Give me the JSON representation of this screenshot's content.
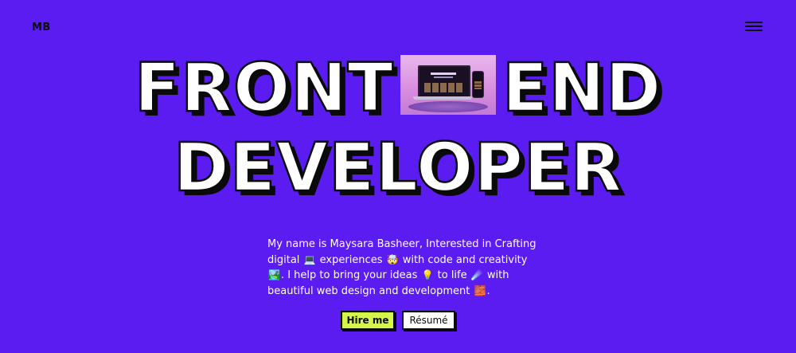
{
  "header": {
    "logo": "MB",
    "menu_icon": "hamburger-menu-icon"
  },
  "hero": {
    "line1_left": "FRONT",
    "line1_right": "END",
    "line2": "DEVELOPER",
    "image_description_icon": "laptop-mockup-image"
  },
  "intro": {
    "part1": "My name is Maysara Basheer, Interested in Crafting digital",
    "emoji1": "💻",
    "part2": "experiences",
    "emoji2": "🤯",
    "part3": "with code and creativity",
    "emoji3": "🏞️",
    "part4": ". I help to bring your ideas",
    "emoji4": "💡",
    "part5": "to life",
    "emoji5": "☄️",
    "part6": "with beautiful web design and development",
    "emoji6": "🧱",
    "part7": "."
  },
  "actions": {
    "hire_label": "Hire me",
    "resume_label": "Résumé"
  },
  "colors": {
    "background": "#5b1cf2",
    "text_dark": "#0a0a0a",
    "accent_lime": "#d6f54a",
    "white": "#ffffff"
  }
}
